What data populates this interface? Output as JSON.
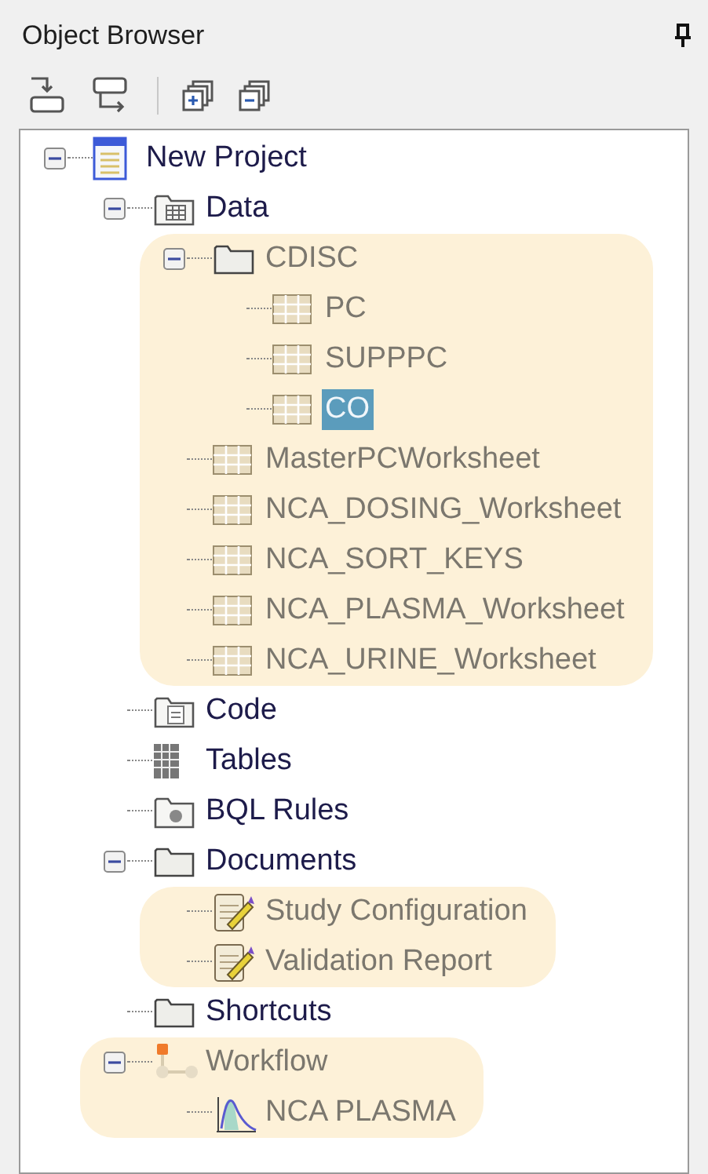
{
  "panel": {
    "title": "Object Browser"
  },
  "tree": [
    {
      "label": "New Project",
      "kind": "project",
      "expanded": true,
      "selected": false,
      "highlighted": false,
      "children": [
        {
          "label": "Data",
          "kind": "data",
          "expanded": true,
          "selected": false,
          "highlighted": false,
          "children": [
            {
              "label": "CDISC",
              "kind": "folder",
              "expanded": true,
              "selected": false,
              "highlighted": true,
              "children": [
                {
                  "label": "PC",
                  "kind": "table",
                  "selected": false,
                  "highlighted": true
                },
                {
                  "label": "SUPPPC",
                  "kind": "table",
                  "selected": false,
                  "highlighted": true
                },
                {
                  "label": "CO",
                  "kind": "table",
                  "selected": true,
                  "highlighted": true
                }
              ]
            },
            {
              "label": "MasterPCWorksheet",
              "kind": "table",
              "selected": false,
              "highlighted": true
            },
            {
              "label": "NCA_DOSING_Worksheet",
              "kind": "table",
              "selected": false,
              "highlighted": true
            },
            {
              "label": "NCA_SORT_KEYS",
              "kind": "table",
              "selected": false,
              "highlighted": true
            },
            {
              "label": "NCA_PLASMA_Worksheet",
              "kind": "table",
              "selected": false,
              "highlighted": true
            },
            {
              "label": "NCA_URINE_Worksheet",
              "kind": "table",
              "selected": false,
              "highlighted": true
            }
          ]
        },
        {
          "label": "Code",
          "kind": "code",
          "selected": false,
          "highlighted": false
        },
        {
          "label": "Tables",
          "kind": "tables",
          "selected": false,
          "highlighted": false
        },
        {
          "label": "BQL Rules",
          "kind": "bql",
          "selected": false,
          "highlighted": false
        },
        {
          "label": "Documents",
          "kind": "folder",
          "expanded": true,
          "selected": false,
          "highlighted": false,
          "children": [
            {
              "label": "Study Configuration",
              "kind": "document",
              "selected": false,
              "highlighted": true
            },
            {
              "label": "Validation Report",
              "kind": "document",
              "selected": false,
              "highlighted": true
            }
          ]
        },
        {
          "label": "Shortcuts",
          "kind": "folder",
          "selected": false,
          "highlighted": false
        },
        {
          "label": "Workflow",
          "kind": "workflow",
          "expanded": true,
          "selected": false,
          "highlighted": true,
          "children": [
            {
              "label": "NCA PLASMA",
              "kind": "nca",
              "selected": false,
              "highlighted": true
            }
          ]
        }
      ]
    }
  ]
}
